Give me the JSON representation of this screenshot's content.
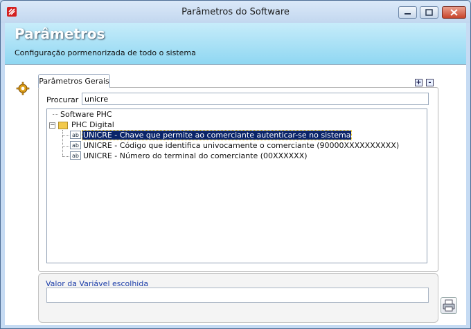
{
  "window": {
    "title": "Parâmetros do Software",
    "close_color": "#c8452b"
  },
  "header": {
    "title": "Parâmetros",
    "subtitle": "Configuração pormenorizada de todo o sistema"
  },
  "tabs": [
    {
      "label": "Parâmetros Gerais"
    }
  ],
  "tree_buttons": {
    "expand": "+",
    "collapse": "-"
  },
  "search": {
    "label": "Procurar :",
    "value": "unicre"
  },
  "tree": {
    "root": "Software PHC",
    "group": "PHC Digital",
    "items": [
      {
        "icon": "ab",
        "label": "UNICRE - Chave que permite ao comerciante autenticar-se no sistema",
        "selected": true
      },
      {
        "icon": "ab",
        "label": "UNICRE - Código que identifica univocamente o comerciante (90000XXXXXXXXXX)",
        "selected": false
      },
      {
        "icon": "ab",
        "label": "UNICRE - Número do terminal do comerciante (00XXXXXX)",
        "selected": false
      }
    ]
  },
  "value_group": {
    "label": "Valor da Variável escolhida",
    "value": ""
  },
  "icons": {
    "app": "app-logo-icon",
    "settings": "gear-icon",
    "print": "print-icon",
    "folder": "folder-icon",
    "field": "text-field-icon"
  }
}
